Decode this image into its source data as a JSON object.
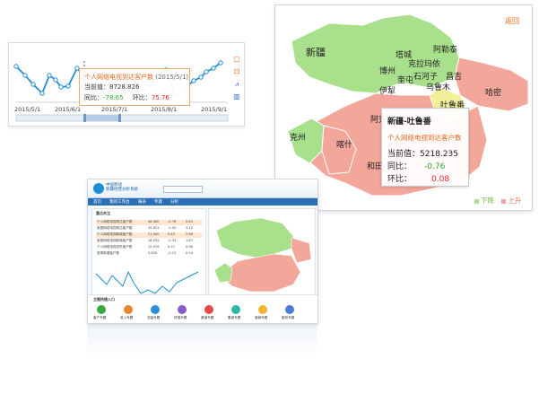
{
  "line_chart": {
    "x_labels": [
      "2015/5/1",
      "2015/6/1",
      "2015/7/1",
      "2015/8/1",
      "2015/9/1"
    ],
    "tooltip": {
      "title": "个人网络电视到达客户数",
      "date": "(2015/5/1)",
      "current_label": "当前值：",
      "current_value": "8728.826",
      "yoy_label": "同比：",
      "yoy_value": "-78.65",
      "mom_label": "环比：",
      "mom_value": "75.76"
    },
    "toolbar_icons": [
      "restore-icon",
      "save-icon",
      "line-chart-icon",
      "bar-chart-icon"
    ],
    "color_line": "#1f8ed6"
  },
  "map": {
    "back_label": "返回",
    "regions": [
      {
        "name": "新疆",
        "color": "#a8e08c"
      },
      {
        "name": "塔城",
        "color": "#a8e08c"
      },
      {
        "name": "阿勒泰",
        "color": "#a8e08c"
      },
      {
        "name": "克拉玛依",
        "color": "#a8e08c"
      },
      {
        "name": "博州",
        "color": "#a8e08c"
      },
      {
        "name": "石河子",
        "color": "#a8e08c"
      },
      {
        "name": "昌吉",
        "color": "#a8e08c"
      },
      {
        "name": "奎屯",
        "color": "#a8e08c"
      },
      {
        "name": "乌鲁木",
        "color": "#a8e08c"
      },
      {
        "name": "伊犁",
        "color": "#a8e08c"
      },
      {
        "name": "吐鲁番",
        "color": "#f3f09a"
      },
      {
        "name": "哈密",
        "color": "#f3a79a"
      },
      {
        "name": "阿克",
        "color": "#f3a79a"
      },
      {
        "name": "克州",
        "color": "#a8e08c"
      },
      {
        "name": "喀什",
        "color": "#f3a79a"
      },
      {
        "name": "和田",
        "color": "#f3a79a"
      }
    ],
    "tooltip": {
      "title": "新疆-吐鲁番",
      "subtitle": "个人网络电视到达客户数",
      "current_label": "当前值：",
      "current_value": "5218.235",
      "yoy_label": "同比：",
      "yoy_value": "-0.76",
      "mom_label": "环比：",
      "mom_value": "0.08"
    },
    "legend": [
      {
        "label": "下降",
        "color": "#a8e08c"
      },
      {
        "label": "上升",
        "color": "#f3a79a"
      }
    ]
  },
  "dashboard": {
    "brand_line1": "中国移动",
    "brand_line2": "新疆经营分析系统",
    "nav": [
      "首页",
      "我的工作台",
      "报表",
      "专题",
      "分析"
    ],
    "panel_title": "重点关注",
    "rows": [
      {
        "name": "个人网络电视到达客户数",
        "v1": "46,360",
        "v2": "-0.76",
        "v3": "5.83"
      },
      {
        "name": "家庭网络电视到达客户数",
        "v1": "35,821",
        "v2": "-1.02",
        "v3": "3.12"
      },
      {
        "name": "个人网络电视新增客户数",
        "v1": "21,440",
        "v2": "0.45",
        "v3": "2.60"
      },
      {
        "name": "家庭网络电视新增客户数",
        "v1": "18,932",
        "v2": "-0.33",
        "v3": "1.87"
      },
      {
        "name": "个人网络电视流失客户数",
        "v1": "12,019",
        "v2": "0.21",
        "v3": "0.98"
      },
      {
        "name": "宽带新增客户数",
        "v1": "9,820",
        "v2": "-0.12",
        "v3": "0.54"
      }
    ],
    "bottom_title": "主题快捷入口",
    "shortcuts": [
      "客户专题",
      "收入专题",
      "流量专题",
      "终端专题",
      "渠道专题",
      "集团专题",
      "营销专题",
      "服务专题"
    ]
  }
}
